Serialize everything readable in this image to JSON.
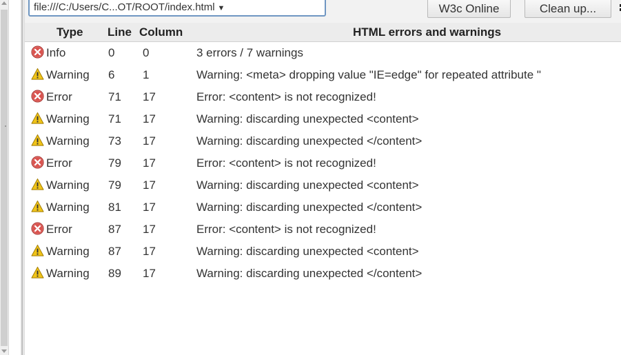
{
  "toolbar": {
    "file_path": "file:///C:/Users/C...OT/ROOT/index.html",
    "w3c_label": "W3c Online",
    "cleanup_label": "Clean up..."
  },
  "table": {
    "headers": {
      "type": "Type",
      "line": "Line",
      "column": "Column",
      "message": "HTML errors and warnings"
    },
    "rows": [
      {
        "kind": "error-icon",
        "type": "Info",
        "line": "0",
        "column": "0",
        "message": "3 errors / 7 warnings"
      },
      {
        "kind": "warning-icon",
        "type": "Warning",
        "line": "6",
        "column": "1",
        "message": "Warning: <meta> dropping value \"IE=edge\" for repeated attribute \""
      },
      {
        "kind": "error-icon",
        "type": "Error",
        "line": "71",
        "column": "17",
        "message": "Error: <content> is not recognized!"
      },
      {
        "kind": "warning-icon",
        "type": "Warning",
        "line": "71",
        "column": "17",
        "message": "Warning: discarding unexpected <content>"
      },
      {
        "kind": "warning-icon",
        "type": "Warning",
        "line": "73",
        "column": "17",
        "message": "Warning: discarding unexpected </content>"
      },
      {
        "kind": "error-icon",
        "type": "Error",
        "line": "79",
        "column": "17",
        "message": "Error: <content> is not recognized!"
      },
      {
        "kind": "warning-icon",
        "type": "Warning",
        "line": "79",
        "column": "17",
        "message": "Warning: discarding unexpected <content>"
      },
      {
        "kind": "warning-icon",
        "type": "Warning",
        "line": "81",
        "column": "17",
        "message": "Warning: discarding unexpected </content>"
      },
      {
        "kind": "error-icon",
        "type": "Error",
        "line": "87",
        "column": "17",
        "message": "Error: <content> is not recognized!"
      },
      {
        "kind": "warning-icon",
        "type": "Warning",
        "line": "87",
        "column": "17",
        "message": "Warning: discarding unexpected <content>"
      },
      {
        "kind": "warning-icon",
        "type": "Warning",
        "line": "89",
        "column": "17",
        "message": "Warning: discarding unexpected </content>"
      }
    ]
  },
  "colors": {
    "error": "#d9534f",
    "warning": "#f0c419",
    "select_border": "#6f96c2"
  }
}
